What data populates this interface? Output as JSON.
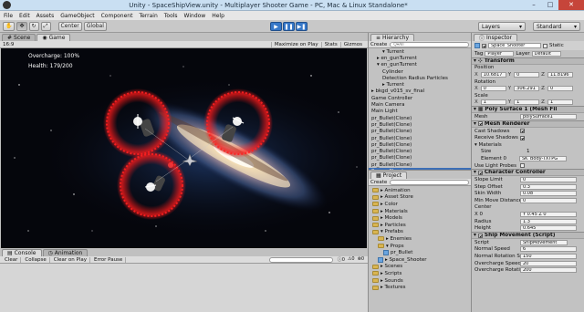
{
  "window": {
    "title": "Unity - SpaceShipView.unity - Multiplayer Shooter Game - PC, Mac & Linux Standalone*",
    "minimize": "–",
    "maximize": "□",
    "close": "✕"
  },
  "menu": [
    "File",
    "Edit",
    "Assets",
    "GameObject",
    "Component",
    "Terrain",
    "Tools",
    "Window",
    "Help"
  ],
  "toolbar": {
    "center_label": "Center",
    "global_label": "Global",
    "layers_label": "Layers",
    "layout_label": "Standard"
  },
  "game": {
    "tab_scene": "Scene",
    "tab_game": "Game",
    "aspect": "16:9",
    "maximize_on_play": "Maximize on Play",
    "stats": "Stats",
    "gizmos": "Gizmos",
    "hud_overcharge": "Overcharge: 100%",
    "hud_health": "Health: 179/200"
  },
  "console": {
    "tab_console": "Console",
    "tab_animation": "Animation",
    "buttons": [
      "Clear",
      "Collapse",
      "Clear on Play",
      "Error Pause"
    ],
    "badges": [
      "0",
      "0",
      "0"
    ]
  },
  "hierarchy": {
    "tab": "Hierarchy",
    "create": "Create",
    "search_placeholder": "Q▾All",
    "rows": [
      {
        "label": "▾ Turrent",
        "indent": 2,
        "selected": false
      },
      {
        "label": "▸ en_gunTurrent",
        "indent": 1,
        "selected": false
      },
      {
        "label": "▾ en_gunTurrent",
        "indent": 1,
        "selected": false
      },
      {
        "label": "Cylinder",
        "indent": 2,
        "selected": false
      },
      {
        "label": "Detection Radius Particles",
        "indent": 2,
        "selected": false
      },
      {
        "label": "▸ Turrent",
        "indent": 2,
        "selected": false
      },
      {
        "label": "▸ bkgd_v015_sv_final",
        "indent": 0,
        "selected": false
      },
      {
        "label": "Game Controller",
        "indent": 0,
        "selected": false
      },
      {
        "label": "Main Camera",
        "indent": 0,
        "selected": false
      },
      {
        "label": "Main Light",
        "indent": 0,
        "selected": false
      },
      {
        "label": "pr_Bullet(Clone)",
        "indent": 0,
        "selected": false
      },
      {
        "label": "pr_Bullet(Clone)",
        "indent": 0,
        "selected": false
      },
      {
        "label": "pr_Bullet(Clone)",
        "indent": 0,
        "selected": false
      },
      {
        "label": "pr_Bullet(Clone)",
        "indent": 0,
        "selected": false
      },
      {
        "label": "pr_Bullet(Clone)",
        "indent": 0,
        "selected": false
      },
      {
        "label": "pr_Bullet(Clone)",
        "indent": 0,
        "selected": false
      },
      {
        "label": "pr_Bullet(Clone)",
        "indent": 0,
        "selected": false
      },
      {
        "label": "pr_Bullet(Clone)",
        "indent": 0,
        "selected": false
      },
      {
        "label": "Space_Shooter",
        "indent": 0,
        "selected": true
      }
    ]
  },
  "project": {
    "tab": "Project",
    "create": "Create",
    "items": [
      {
        "label": "▸ Animation",
        "indent": 0,
        "type": "folder"
      },
      {
        "label": "▸ Asset Store",
        "indent": 0,
        "type": "folder"
      },
      {
        "label": "▸ Color",
        "indent": 0,
        "type": "folder"
      },
      {
        "label": "▸ Materials",
        "indent": 0,
        "type": "folder"
      },
      {
        "label": "▸ Models",
        "indent": 0,
        "type": "folder"
      },
      {
        "label": "▸ Particles",
        "indent": 0,
        "type": "folder"
      },
      {
        "label": "▾ Prefabs",
        "indent": 0,
        "type": "folder"
      },
      {
        "label": "▸ Enemies",
        "indent": 1,
        "type": "folder"
      },
      {
        "label": "▾ Props",
        "indent": 1,
        "type": "folder"
      },
      {
        "label": "pr_Bullet",
        "indent": 2,
        "type": "prefab"
      },
      {
        "label": "▸ Space_Shooter",
        "indent": 1,
        "type": "prefab"
      },
      {
        "label": "▸ Scenes",
        "indent": 0,
        "type": "folder"
      },
      {
        "label": "▸ Scripts",
        "indent": 0,
        "type": "folder"
      },
      {
        "label": "▸ Sounds",
        "indent": 0,
        "type": "folder"
      },
      {
        "label": "▸ Textures",
        "indent": 0,
        "type": "folder"
      }
    ]
  },
  "inspector": {
    "tab": "Inspector",
    "object_name": "Space_Shooter",
    "static_label": "Static",
    "tag_label": "Tag",
    "tag_value": "Player",
    "layer_label": "Layer",
    "layer_value": "Default",
    "transform": {
      "header": "Transform",
      "position_label": "Position",
      "position": {
        "x": "10.6817",
        "y": "0",
        "z": "11.8196"
      },
      "rotation_label": "Rotation",
      "rotation": {
        "x": "0",
        "y": "306.291",
        "z": "0"
      },
      "scale_label": "Scale",
      "scale": {
        "x": "1",
        "y": "1",
        "z": "1"
      }
    },
    "mesh_filter": {
      "header": "Poly Surface 1 (Mesh Fil",
      "mesh_label": "Mesh",
      "mesh_value": "polySurface1"
    },
    "mesh_renderer": {
      "header": "Mesh Renderer",
      "cast_shadows": "Cast Shadows",
      "receive_shadows": "Receive Shadows",
      "materials": "▾ Materials",
      "size_label": "Size",
      "size_value": "1",
      "element_label": "Element 0",
      "element_value": "SK_Body-TXTPG",
      "light_probes": "Use Light Probes"
    },
    "character_controller": {
      "header": "Character Controller",
      "fields": [
        {
          "label": "Slope Limit",
          "value": "0"
        },
        {
          "label": "Step Offset",
          "value": "0.3"
        },
        {
          "label": "Skin Width",
          "value": "0.08"
        },
        {
          "label": "Min Move Distance",
          "value": "0"
        },
        {
          "label": "Center",
          "value": ""
        },
        {
          "label": "X 0",
          "value": "Y 0.45   Z 0"
        },
        {
          "label": "Radius",
          "value": "1.3"
        },
        {
          "label": "Height",
          "value": "0.645"
        }
      ]
    },
    "ship_movement": {
      "header": "Ship Movement (Script)",
      "script_label": "Script",
      "script_value": "ShipMovement",
      "rows": [
        {
          "label": "Normal Speed",
          "value": "6"
        },
        {
          "label": "Normal Rotation Spe",
          "value": "150"
        },
        {
          "label": "Overcharge Speed",
          "value": "20"
        },
        {
          "label": "Overcharge Rotatio",
          "value": "200"
        }
      ]
    }
  }
}
